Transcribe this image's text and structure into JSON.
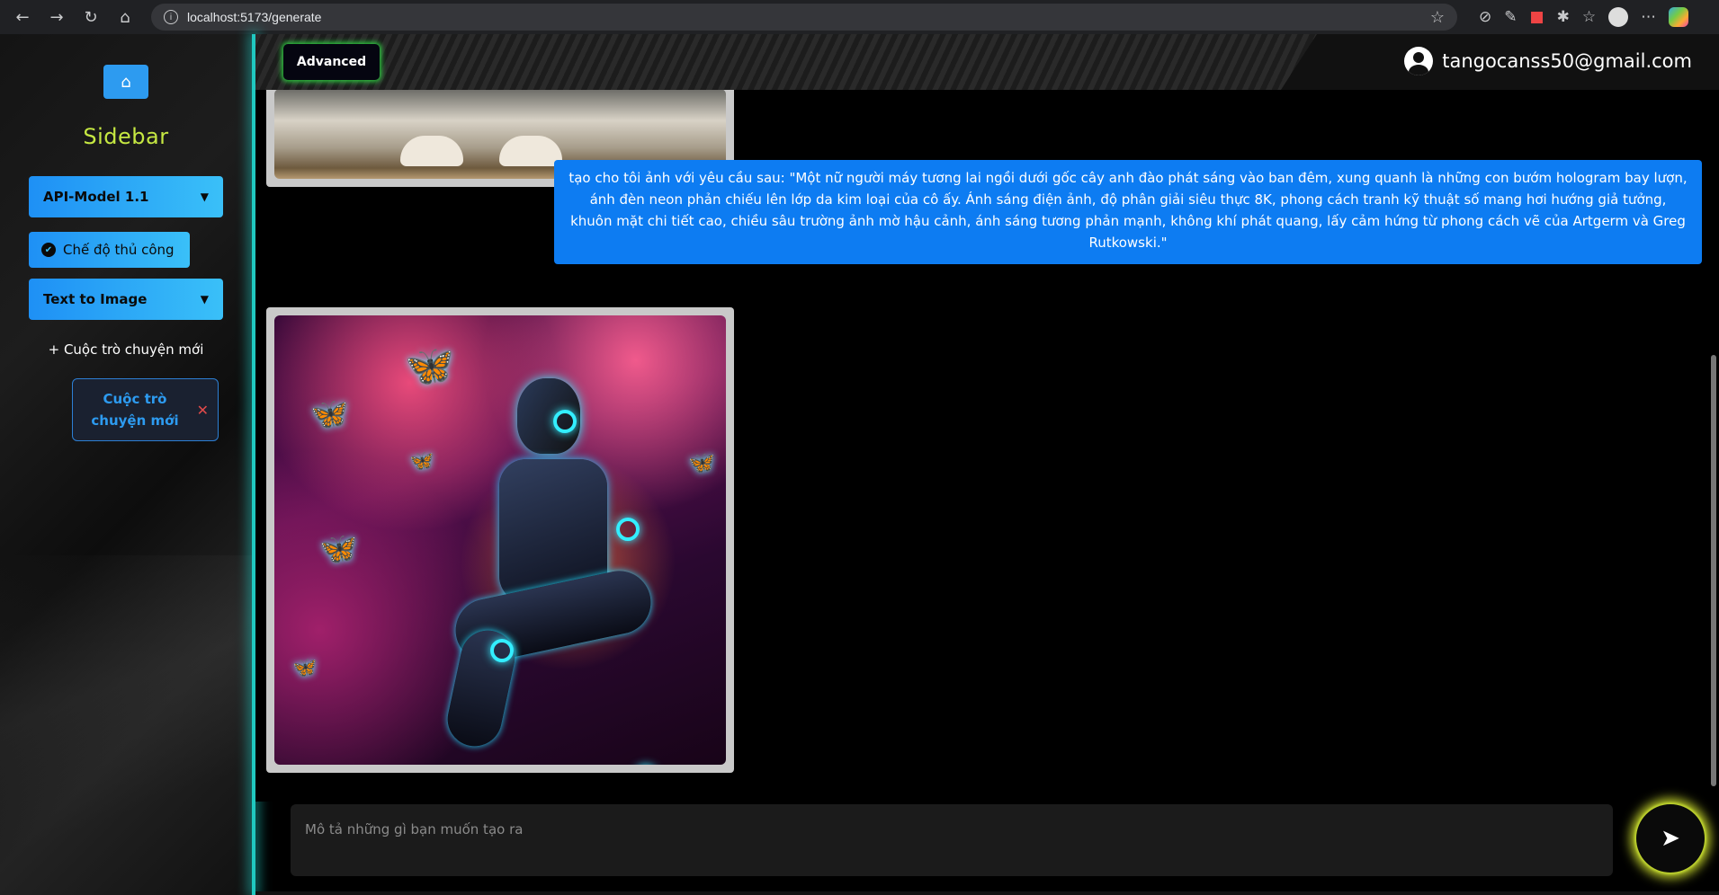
{
  "browser": {
    "url": "localhost:5173/generate"
  },
  "sidebar": {
    "title": "Sidebar",
    "model_select": "API-Model 1.1",
    "manual_mode_label": "Chế độ thủ công",
    "mode_select": "Text to Image",
    "new_chat_link": "+ Cuộc trò chuyện mới",
    "chat_items": [
      {
        "label": "Cuộc trò chuyện mới"
      }
    ]
  },
  "header": {
    "advanced_label": "Advanced",
    "user_email": "tangocanss50@gmail.com"
  },
  "chat": {
    "user_message": "tạo cho tôi ảnh với yêu cầu sau: \"Một nữ người máy tương lai ngồi dưới gốc cây anh đào phát sáng vào ban đêm, xung quanh là những con bướm hologram bay lượn, ánh đèn neon phản chiếu lên lớp da kim loại của cô ấy. Ánh sáng điện ảnh, độ phân giải siêu thực 8K, phong cách tranh kỹ thuật số mang hơi hướng giả tưởng, khuôn mặt chi tiết cao, chiều sâu trường ảnh mờ hậu cảnh, ánh sáng tương phản mạnh, không khí phát quang, lấy cảm hứng từ phong cách vẽ của Artgerm và Greg Rutkowski.\""
  },
  "input": {
    "placeholder": "Mô tả những gì bạn muốn tạo ra"
  },
  "colors": {
    "accent_blue": "#1e90f5",
    "sidebar_title": "#c6e842",
    "divider_glow": "#20c8c0",
    "send_glow": "#c8d82c"
  }
}
